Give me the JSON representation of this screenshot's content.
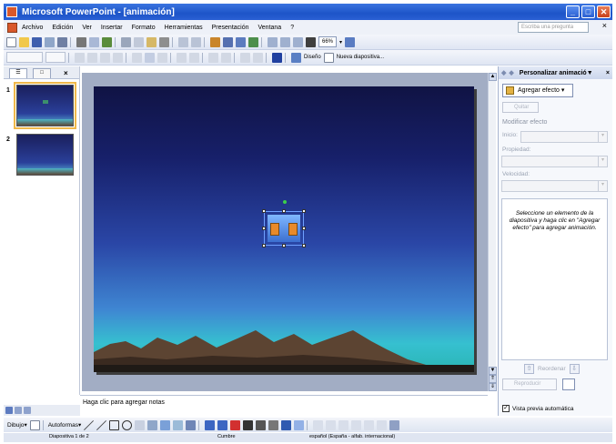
{
  "window": {
    "title": "Microsoft PowerPoint - [animación]"
  },
  "menu": {
    "items": [
      "Archivo",
      "Edición",
      "Ver",
      "Insertar",
      "Formato",
      "Herramientas",
      "Presentación",
      "Ventana",
      "?"
    ],
    "help_placeholder": "Escriba una pregunta",
    "close_symbol": "×"
  },
  "toolbar": {
    "zoom": "66%",
    "design_label": "Diseño",
    "new_slide_label": "Nueva diapositiva..."
  },
  "slides_panel": {
    "tab_outline": "☰",
    "tab_slides": "□",
    "close_symbol": "×",
    "slide_numbers": [
      "1",
      "2"
    ]
  },
  "notes": {
    "placeholder": "Haga clic para agregar notas"
  },
  "task_pane": {
    "title": "Personalizar animació",
    "add_effect_button": "Agregar efecto",
    "remove_button": "Quitar",
    "modify_section": "Modificar efecto",
    "start_label": "Inicio:",
    "property_label": "Propiedad:",
    "speed_label": "Velocidad:",
    "instructions": "Seleccione un elemento de la diapositiva y haga clic en \"Agregar efecto\" para agregar animación.",
    "reorder_label": "Reordenar",
    "play_button": "Reproducir",
    "autopreview_label": "Vista previa automática",
    "autopreview_checked": true
  },
  "draw_toolbar": {
    "draw_label": "Dibujo",
    "autoshapes_label": "Autoformas"
  },
  "status_bar": {
    "slide_info": "Diapositiva 1 de 2",
    "design_name": "Cumbre",
    "language": "español (España - alfab. internacional)"
  }
}
